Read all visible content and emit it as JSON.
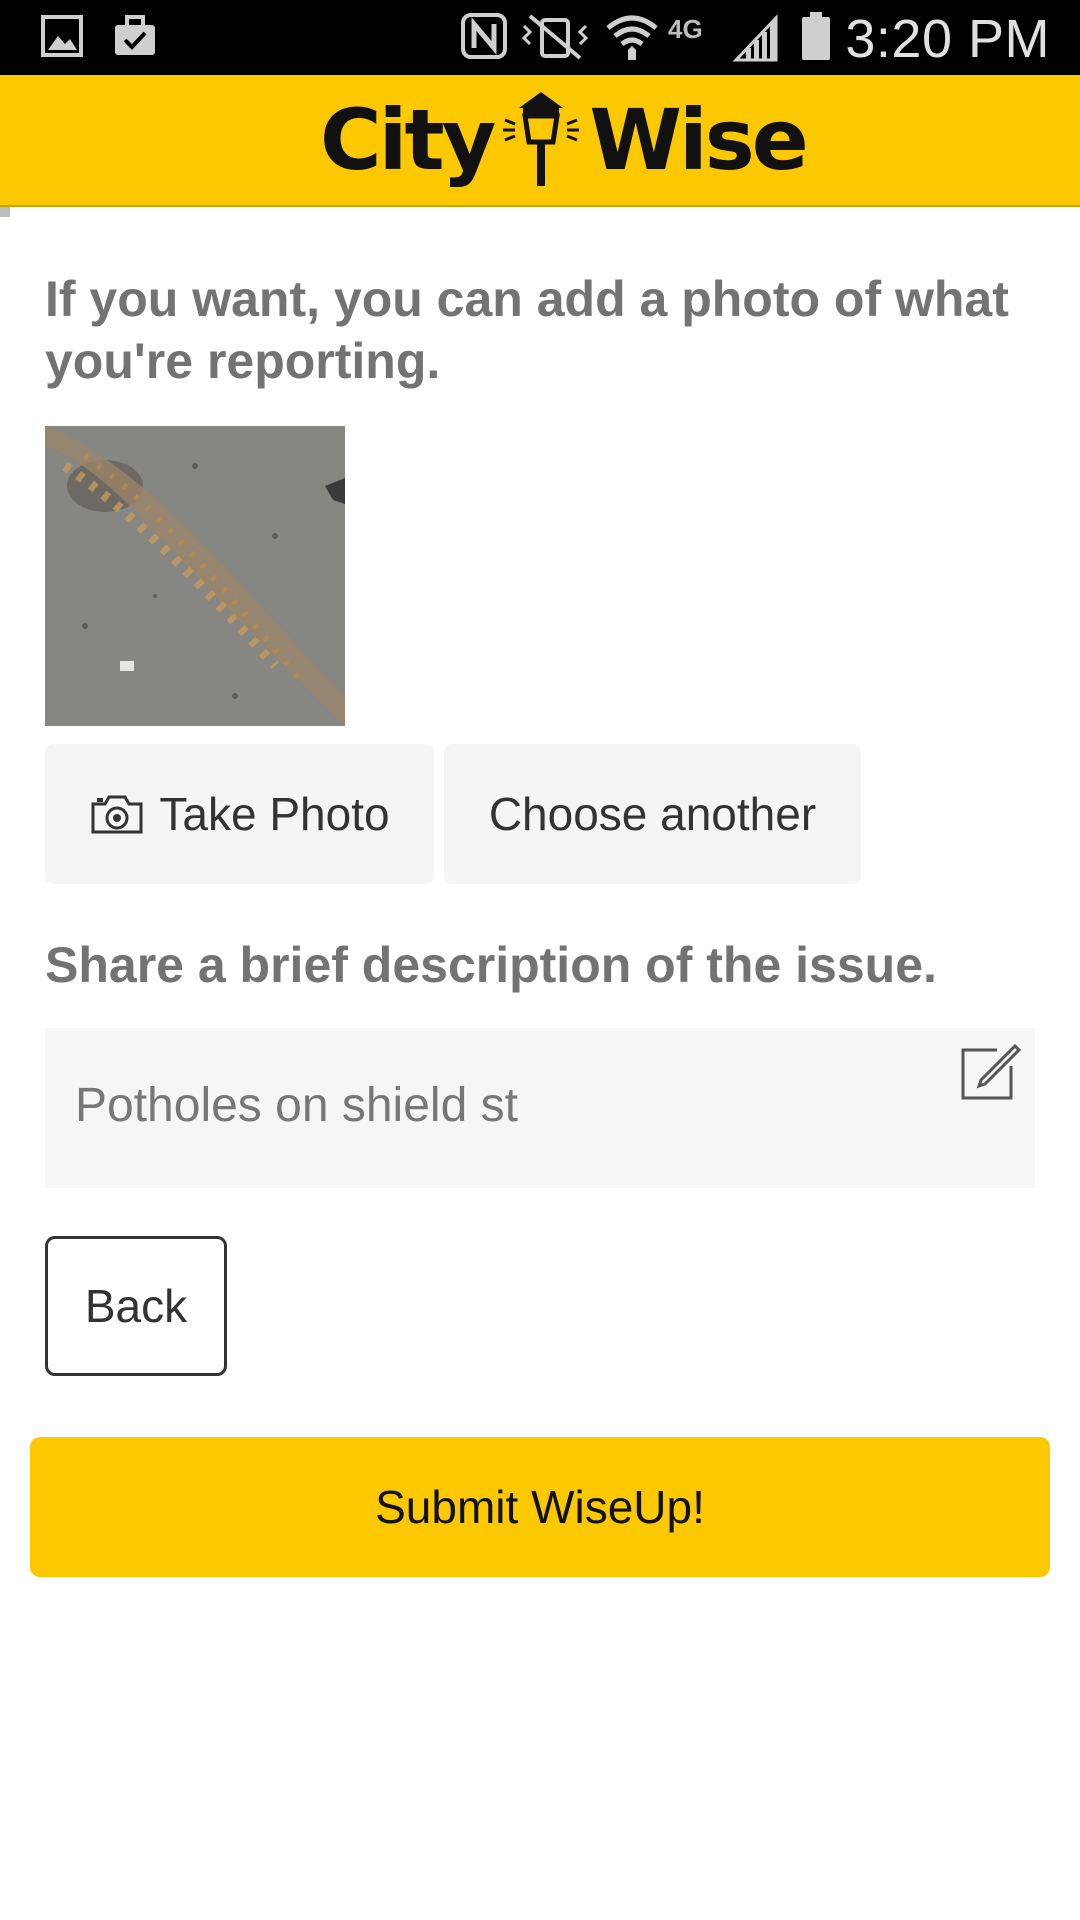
{
  "status_bar": {
    "time": "3:20 PM",
    "network_label": "4G",
    "icons": [
      "gallery-icon",
      "briefcase-check-icon",
      "nfc-icon",
      "vibrate-mute-icon",
      "wifi-icon",
      "lte-icon",
      "signal-icon",
      "battery-icon"
    ]
  },
  "header": {
    "logo_left": "City",
    "logo_right": "Wise",
    "logo_icon": "street-lamp-icon",
    "background_color": "#fcc800"
  },
  "photo_section": {
    "prompt": "If you want, you can add a photo of what you're reporting.",
    "take_photo_label": "Take Photo",
    "choose_another_label": "Choose another"
  },
  "description_section": {
    "prompt": "Share a brief description of the issue.",
    "value": "Potholes on shield st"
  },
  "actions": {
    "back_label": "Back",
    "submit_label": "Submit WiseUp!",
    "accent_color": "#fcc800"
  }
}
